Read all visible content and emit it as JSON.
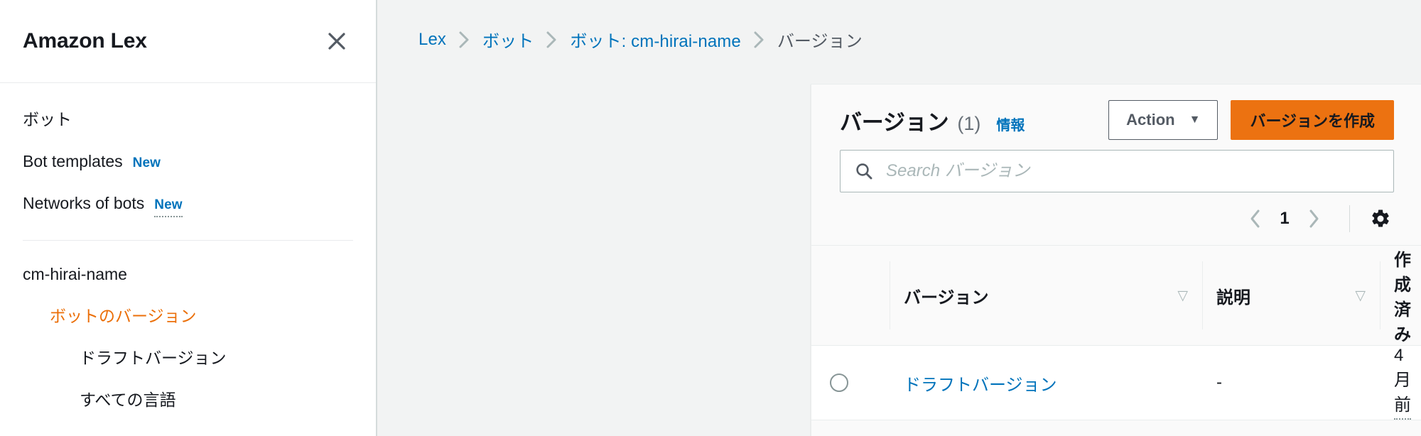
{
  "sidebar": {
    "title": "Amazon Lex",
    "close_icon": "close-icon",
    "items": [
      {
        "label": "ボット",
        "level": 1,
        "badge": null,
        "active": false
      },
      {
        "label": "Bot templates",
        "level": 1,
        "badge": "New",
        "badge_dotted": false,
        "active": false
      },
      {
        "label": "Networks of bots",
        "level": 1,
        "badge": "New",
        "badge_dotted": true,
        "active": false
      },
      {
        "label": "cm-hirai-name",
        "level": 1,
        "badge": null,
        "active": false
      },
      {
        "label": "ボットのバージョン",
        "level": 2,
        "badge": null,
        "active": true
      },
      {
        "label": "ドラフトバージョン",
        "level": 3,
        "badge": null,
        "active": false
      },
      {
        "label": "すべての言語",
        "level": 3,
        "badge": null,
        "active": false
      }
    ]
  },
  "breadcrumb": {
    "items": [
      {
        "label": "Lex",
        "current": false
      },
      {
        "label": "ボット",
        "current": false
      },
      {
        "label": "ボット: cm-hirai-name",
        "current": false
      },
      {
        "label": "バージョン",
        "current": true
      }
    ],
    "separator_icon": "chevron-right-icon"
  },
  "card": {
    "title": "バージョン",
    "count": "(1)",
    "info_label": "情報",
    "action_button": "Action",
    "action_caret": "▼",
    "create_button": "バージョンを作成",
    "search": {
      "icon": "search-icon",
      "placeholder": "Search バージョン",
      "value": ""
    },
    "pagination": {
      "prev_icon": "chevron-left-icon",
      "page": "1",
      "next_icon": "chevron-right-icon",
      "settings_icon": "gear-icon"
    },
    "table": {
      "columns": [
        {
          "label": "",
          "name": "select",
          "sort": null
        },
        {
          "label": "バージョン",
          "name": "version",
          "sort": "▽"
        },
        {
          "label": "説明",
          "name": "description",
          "sort": "▽"
        },
        {
          "label": "作成済み",
          "name": "created",
          "sort": "▲"
        }
      ],
      "rows": [
        {
          "selected": false,
          "version": "ドラフトバージョン",
          "description": "-",
          "created": "4 月 前"
        }
      ]
    }
  },
  "colors": {
    "accent_orange": "#ec7211",
    "link_blue": "#0073bb",
    "active_nav": "#eb6f09",
    "text_dark": "#16191f",
    "bg_canvas": "#f2f3f3"
  }
}
